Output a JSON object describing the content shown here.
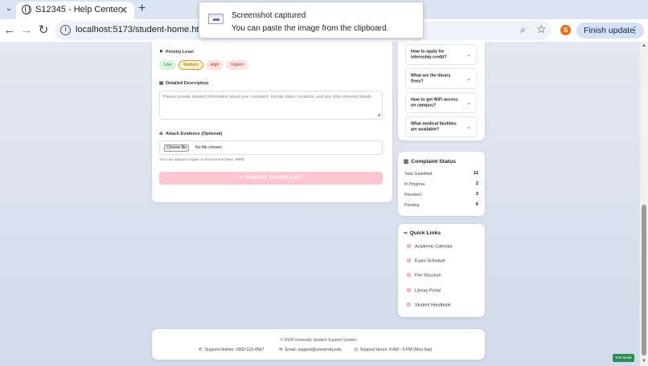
{
  "browser": {
    "tab_title": "S12345 - Help Center",
    "tab_close": "✕",
    "new_tab": "+",
    "url": "localhost:5173/student-home.html",
    "profile_initial": "S",
    "update_button": "Finish update",
    "update_menu": "⋮"
  },
  "notification": {
    "title": "Screenshot captured",
    "body": "You can paste the image from the clipboard."
  },
  "form": {
    "priority_label": "Priority Level",
    "priorities": [
      "Low",
      "Medium",
      "High",
      "Urgent"
    ],
    "selected_priority": "Medium",
    "description_label": "Detailed Description",
    "description_placeholder": "Please provide detailed information about your complaint. Include dates, locations, and any other relevant details.",
    "evidence_label": "Attach Evidence (Optional)",
    "file_button": "Choose file",
    "file_status": "No file chosen",
    "file_hint": "You can upload images or documents (Max: 5MB)",
    "submit_label": "SUBMIT COMPLAINT"
  },
  "faq": [
    "How to apply for internship credit?",
    "What are the library fines?",
    "How to get WiFi access on campus?",
    "What medical facilities are available?"
  ],
  "status": {
    "title": "Complaint Status",
    "rows": [
      {
        "label": "Total Submitted",
        "value": "11"
      },
      {
        "label": "In Progress",
        "value": "2"
      },
      {
        "label": "Resolved",
        "value": "3"
      },
      {
        "label": "Pending",
        "value": "6"
      }
    ]
  },
  "quick_links": {
    "title": "Quick Links",
    "items": [
      "Academic Calendar",
      "Exam Schedule",
      "Fee Structure",
      "Library Portal",
      "Student Handbook"
    ]
  },
  "footer": {
    "copyright": "© 2024 University Student Support System",
    "hotline": "Support Hotline: 1800-123-4567",
    "email": "Email: support@university.edu",
    "hours": "Support Hours: 9 AM - 6 PM (Mon-Sat)"
  },
  "test_mode": "Test Mode",
  "colors": {
    "accent_pink": "#fbc6cf",
    "low": "#d9f2de",
    "medium": "#fbf0c9",
    "high": "#fbe3e3",
    "profile": "#e8711a",
    "test_mode": "#2e8b57"
  }
}
